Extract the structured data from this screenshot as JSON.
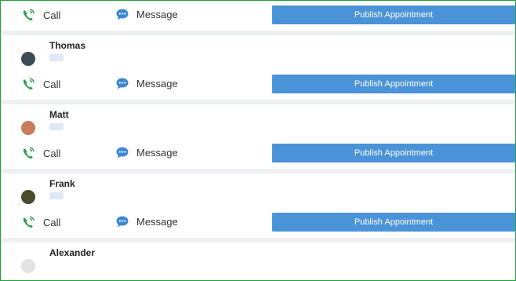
{
  "actions": {
    "call_label": "Call",
    "message_label": "Message",
    "publish_label": "Publish Appointment"
  },
  "people": [
    {
      "name": "Thomas",
      "avatar_color": "#3f4a57"
    },
    {
      "name": "Matt",
      "avatar_color": "#c97b5a"
    },
    {
      "name": "Frank",
      "avatar_color": "#4b4a2a"
    },
    {
      "name": "Alexander",
      "avatar_color": "#e3e3e3"
    }
  ],
  "colors": {
    "border": "#1ea03a",
    "publish_button": "#4a93d8",
    "call_icon": "#2a9d4b",
    "message_icon": "#3b87d6",
    "separator": "#eef0f3"
  },
  "icons": {
    "call": "phone-ringing-icon",
    "message": "chat-bubble-icon"
  }
}
